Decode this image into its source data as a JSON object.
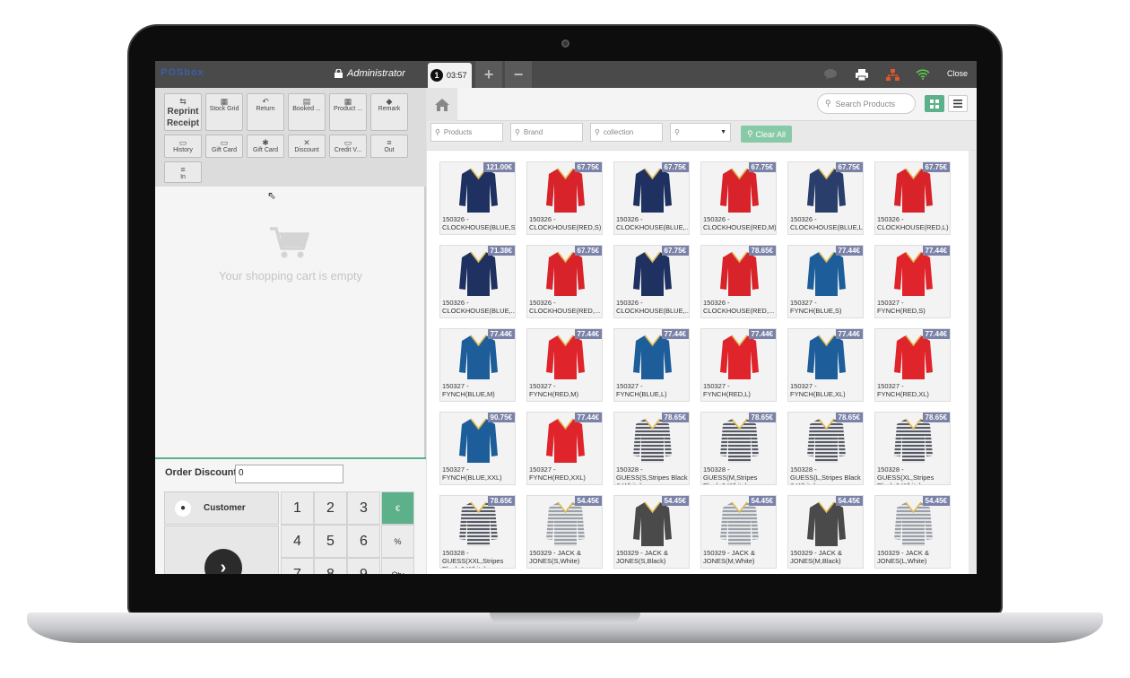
{
  "topbar": {
    "logo": "POSbox",
    "user": "Administrator",
    "order_number": "1",
    "order_time": "03:57",
    "add_label": "+",
    "remove_label": "−",
    "close_label": "Close"
  },
  "controls": [
    {
      "label": "Reprint Receipt",
      "icon": "print-icon"
    },
    {
      "label": "Stock Grid",
      "icon": "grid-icon"
    },
    {
      "label": "Return",
      "icon": "undo-icon"
    },
    {
      "label": "Booked ...",
      "icon": "book-icon"
    },
    {
      "label": "Product ...",
      "icon": "grid-icon"
    },
    {
      "label": "Remark",
      "icon": "tag-icon"
    },
    {
      "label": "History",
      "icon": "history-icon"
    },
    {
      "label": "Gift Card",
      "icon": "card-icon"
    },
    {
      "label": "Gift Card",
      "icon": "gift-icon"
    },
    {
      "label": "Discount",
      "icon": "times-icon"
    },
    {
      "label": "Credit V...",
      "icon": "card-icon"
    },
    {
      "label": "Out",
      "icon": "coins-icon"
    },
    {
      "label": "In",
      "icon": "coins-icon"
    }
  ],
  "cart": {
    "empty_text": "Your shopping cart is empty"
  },
  "numpad": {
    "order_discount_label": "Order Discount",
    "order_discount_value": "0",
    "customer_label": "Customer",
    "keys": [
      "1",
      "2",
      "3",
      "€",
      "4",
      "5",
      "6",
      "%",
      "7",
      "8",
      "9",
      "Qty"
    ]
  },
  "search": {
    "placeholder": "Search Products"
  },
  "filters": {
    "products": "Products",
    "brand": "Brand",
    "collection": "collection",
    "clear_all": "Clear All"
  },
  "products": [
    {
      "price": "121.00€",
      "name": "150326 - CLOCKHOUSE(BLUE,S)",
      "color": "#1f3160"
    },
    {
      "price": "67.75€",
      "name": "150326 - CLOCKHOUSE(RED,S)",
      "color": "#d8232a"
    },
    {
      "price": "67.75€",
      "name": "150326 - CLOCKHOUSE(BLUE,...",
      "color": "#1f3160"
    },
    {
      "price": "67.75€",
      "name": "150326 - CLOCKHOUSE(RED,M)",
      "color": "#d8232a"
    },
    {
      "price": "67.75€",
      "name": "150326 - CLOCKHOUSE(BLUE,L)",
      "color": "#2a3e6b"
    },
    {
      "price": "67.75€",
      "name": "150326 - CLOCKHOUSE(RED,L)",
      "color": "#d8232a"
    },
    {
      "price": "71.38€",
      "name": "150326 - CLOCKHOUSE(BLUE,...",
      "color": "#1f3160"
    },
    {
      "price": "67.75€",
      "name": "150326 - CLOCKHOUSE(RED,...",
      "color": "#d8232a"
    },
    {
      "price": "67.75€",
      "name": "150326 - CLOCKHOUSE(BLUE,...",
      "color": "#1f3160"
    },
    {
      "price": "78.65€",
      "name": "150326 - CLOCKHOUSE(RED,...",
      "color": "#d8232a"
    },
    {
      "price": "77.44€",
      "name": "150327 - FYNCH(BLUE,S)",
      "color": "#1d5e9a"
    },
    {
      "price": "77.44€",
      "name": "150327 - FYNCH(RED,S)",
      "color": "#e0242b"
    },
    {
      "price": "77.44€",
      "name": "150327 - FYNCH(BLUE,M)",
      "color": "#1d5e9a"
    },
    {
      "price": "77.44€",
      "name": "150327 - FYNCH(RED,M)",
      "color": "#e0242b"
    },
    {
      "price": "77.44€",
      "name": "150327 - FYNCH(BLUE,L)",
      "color": "#1d5e9a"
    },
    {
      "price": "77.44€",
      "name": "150327 - FYNCH(RED,L)",
      "color": "#e0242b"
    },
    {
      "price": "77.44€",
      "name": "150327 - FYNCH(BLUE,XL)",
      "color": "#1d5e9a"
    },
    {
      "price": "77.44€",
      "name": "150327 - FYNCH(RED,XL)",
      "color": "#e0242b"
    },
    {
      "price": "90.75€",
      "name": "150327 - FYNCH(BLUE,XXL)",
      "color": "#1d5e9a"
    },
    {
      "price": "77.44€",
      "name": "150327 - FYNCH(RED,XXL)",
      "color": "#e0242b"
    },
    {
      "price": "78.65€",
      "name": "150328 - GUESS(S,Stripes Black & White)",
      "color": "#555a66"
    },
    {
      "price": "78.65€",
      "name": "150328 - GUESS(M,Stripes Black & White)",
      "color": "#555a66"
    },
    {
      "price": "78.65€",
      "name": "150328 - GUESS(L,Stripes Black & White)",
      "color": "#555a66"
    },
    {
      "price": "78.65€",
      "name": "150328 - GUESS(XL,Stripes Black & White)",
      "color": "#555a66"
    },
    {
      "price": "78.65€",
      "name": "150328 - GUESS(XXL,Stripes Black & White)",
      "color": "#555a66"
    },
    {
      "price": "54.45€",
      "name": "150329 - JACK & JONES(S,White)",
      "color": "#9aa0aa"
    },
    {
      "price": "54.45€",
      "name": "150329 - JACK & JONES(S,Black)",
      "color": "#4a4a4a"
    },
    {
      "price": "54.45€",
      "name": "150329 - JACK & JONES(M,White)",
      "color": "#9aa0aa"
    },
    {
      "price": "54.45€",
      "name": "150329 - JACK & JONES(M,Black)",
      "color": "#4a4a4a"
    },
    {
      "price": "54.45€",
      "name": "150329 - JACK & JONES(L,White)",
      "color": "#9aa0aa"
    }
  ],
  "colors": {
    "accent": "#5cb08a",
    "price_badge": "#7b82a7",
    "topbar": "#4a4a4a"
  }
}
